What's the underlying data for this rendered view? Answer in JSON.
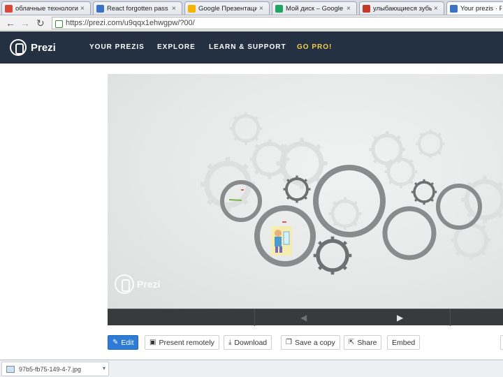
{
  "browser": {
    "tabs": [
      {
        "title": "облачные технологи",
        "favicon_color": "#d94836"
      },
      {
        "title": "React forgotten pass",
        "favicon_color": "#3b73c4"
      },
      {
        "title": "Google Презентации",
        "favicon_color": "#f4b400"
      },
      {
        "title": "Мой диск – Google Д",
        "favicon_color": "#1fa463"
      },
      {
        "title": "улыбающиеся зубы – н",
        "favicon_color": "#c53929"
      },
      {
        "title": "Your prezis · Pre",
        "favicon_color": "#3b73c4"
      }
    ],
    "tab_close_glyph": "×",
    "back_glyph": "←",
    "forward_glyph": "→",
    "reload_glyph": "↻",
    "url": "https://prezi.com/u9qqx1ehwgpw/?00/"
  },
  "prezi_header": {
    "logo_text": "Prezi",
    "menu": [
      "YOUR PREZIS",
      "EXPLORE",
      "LEARN & SUPPORT",
      "GO PRO!"
    ],
    "gopro_color": "#f7c948"
  },
  "stage": {
    "watermark_text": "Prezi",
    "prev_glyph": "◀",
    "next_glyph": "▶"
  },
  "actions": [
    {
      "label": "Edit",
      "icon": "pencil-icon",
      "glyph": "✎",
      "primary": true
    },
    {
      "label": "Present remotely",
      "icon": "monitor-icon",
      "glyph": "▣"
    },
    {
      "label": "Download",
      "icon": "download-icon",
      "glyph": "⤓"
    },
    {
      "label": "Save a copy",
      "icon": "copy-icon",
      "glyph": "❐"
    },
    {
      "label": "Share",
      "icon": "share-icon",
      "glyph": "⇱"
    },
    {
      "label": "Embed",
      "icon": "",
      "glyph": ""
    }
  ],
  "downloads_bar": {
    "file_name": "97b5-fb75-149-4-7.jpg",
    "caret_glyph": "▾"
  },
  "colors": {
    "header_bg": "#243142",
    "edit_button": "#2e7bd6",
    "controls_bg": "#383b3e"
  }
}
